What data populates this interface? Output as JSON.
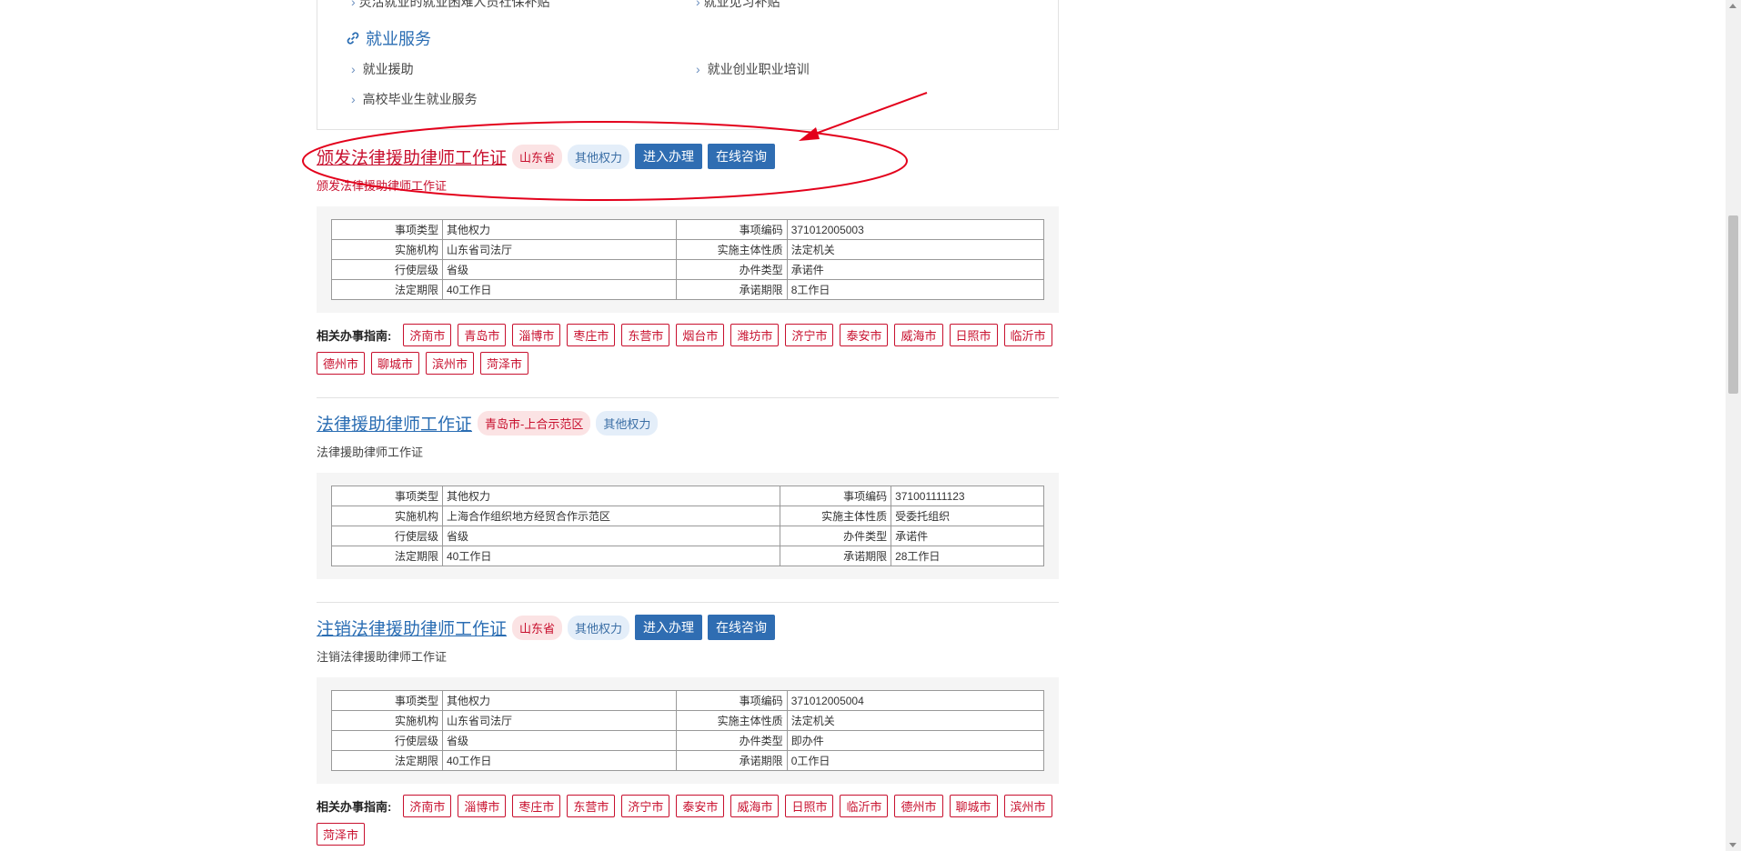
{
  "services": {
    "cut_left": "灵活就业的就业困难人员社保补贴",
    "cut_right": "就业见习补贴",
    "title": "就业服务",
    "links": [
      "就业援助",
      "就业创业职业培训",
      "高校毕业生就业服务"
    ]
  },
  "items": [
    {
      "title": "颁发法律援助律师工作证",
      "region": "山东省",
      "power": "其他权力",
      "subtitle": "颁发法律援助律师工作证",
      "table": [
        [
          "事项类型",
          "其他权力",
          "事项编码",
          "371012005003"
        ],
        [
          "实施机构",
          "山东省司法厅",
          "实施主体性质",
          "法定机关"
        ],
        [
          "行使层级",
          "省级",
          "办件类型",
          "承诺件"
        ],
        [
          "法定期限",
          "40工作日",
          "承诺期限",
          "8工作日"
        ]
      ],
      "guide_label": "相关办事指南:",
      "cities": [
        "济南市",
        "青岛市",
        "淄博市",
        "枣庄市",
        "东营市",
        "烟台市",
        "潍坊市",
        "济宁市",
        "泰安市",
        "威海市",
        "日照市",
        "临沂市",
        "德州市",
        "聊城市",
        "滨州市",
        "菏泽市"
      ]
    },
    {
      "title": "法律援助律师工作证",
      "region": "青岛市-上合示范区",
      "power": "其他权力",
      "subtitle": "法律援助律师工作证",
      "table": [
        [
          "事项类型",
          "其他权力",
          "事项编码",
          "371001111123"
        ],
        [
          "实施机构",
          "上海合作组织地方经贸合作示范区",
          "实施主体性质",
          "受委托组织"
        ],
        [
          "行使层级",
          "省级",
          "办件类型",
          "承诺件"
        ],
        [
          "法定期限",
          "40工作日",
          "承诺期限",
          "28工作日"
        ]
      ]
    },
    {
      "title": "注销法律援助律师工作证",
      "region": "山东省",
      "power": "其他权力",
      "subtitle": "注销法律援助律师工作证",
      "table": [
        [
          "事项类型",
          "其他权力",
          "事项编码",
          "371012005004"
        ],
        [
          "实施机构",
          "山东省司法厅",
          "实施主体性质",
          "法定机关"
        ],
        [
          "行使层级",
          "省级",
          "办件类型",
          "即办件"
        ],
        [
          "法定期限",
          "40工作日",
          "承诺期限",
          "0工作日"
        ]
      ],
      "guide_label": "相关办事指南:",
      "cities": [
        "济南市",
        "淄博市",
        "枣庄市",
        "东营市",
        "济宁市",
        "泰安市",
        "威海市",
        "日照市",
        "临沂市",
        "德州市",
        "聊城市",
        "滨州市",
        "菏泽市"
      ]
    }
  ],
  "buttons": {
    "enter": "进入办理",
    "consult": "在线咨询"
  },
  "colors": {
    "accent_red": "#c8102e",
    "accent_blue": "#2f6db2",
    "annotation": "#e3001b"
  }
}
